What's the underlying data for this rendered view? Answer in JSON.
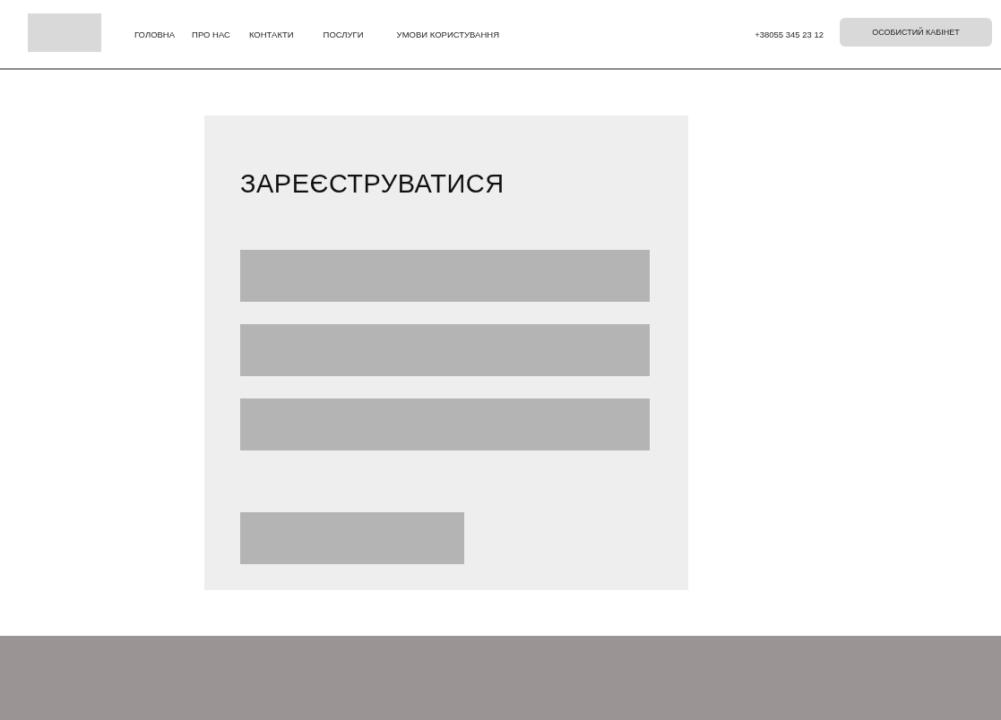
{
  "header": {
    "logo": {
      "kind": "placeholder"
    },
    "nav": [
      {
        "label": "ГОЛОВНА"
      },
      {
        "label": "ПРО НАС"
      },
      {
        "label": "КОНТАКТИ"
      },
      {
        "label": "ПОСЛУГИ"
      },
      {
        "label": "УМОВИ КОРИСТУВАННЯ"
      }
    ],
    "phone": "+38055 345 23 12",
    "account_button": "ОСОБИСТИЙ КАБІНЕТ"
  },
  "form": {
    "title": "ЗАРЕЄСТРУВАТИСЯ",
    "fields": [
      {
        "kind": "input"
      },
      {
        "kind": "input"
      },
      {
        "kind": "input"
      }
    ],
    "submit": {
      "kind": "button"
    }
  },
  "footer": {
    "kind": "band"
  }
}
